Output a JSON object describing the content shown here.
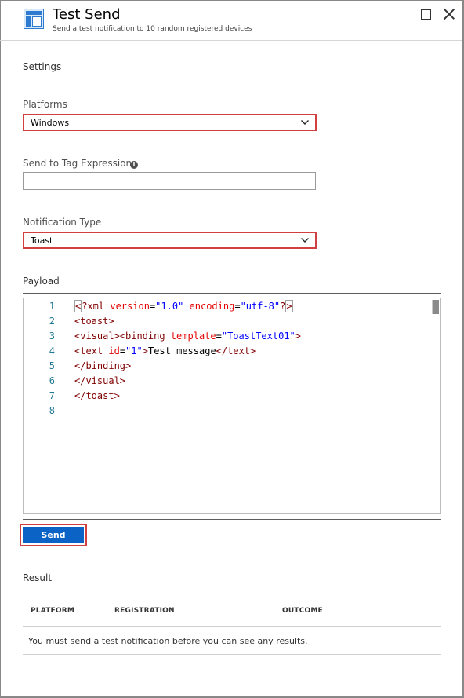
{
  "header": {
    "title": "Test Send",
    "subtitle": "Send a test notification to 10 random registered devices",
    "icon": "blade-icon"
  },
  "settings": {
    "title": "Settings"
  },
  "platforms": {
    "label": "Platforms",
    "selected": "Windows"
  },
  "tag_expression": {
    "label": "Send to Tag Expression",
    "value": "",
    "placeholder": ""
  },
  "notification_type": {
    "label": "Notification Type",
    "selected": "Toast"
  },
  "payload": {
    "label": "Payload",
    "line_numbers": [
      "1",
      "2",
      "3",
      "4",
      "5",
      "6",
      "7",
      "8"
    ]
  },
  "send_button": {
    "label": "Send"
  },
  "result": {
    "title": "Result",
    "columns": [
      "PLATFORM",
      "REGISTRATION",
      "OUTCOME"
    ],
    "empty_message": "You must send a test notification before you can see any results."
  },
  "colors": {
    "accent": "#0b63c5",
    "highlight_border": "#d04040"
  }
}
